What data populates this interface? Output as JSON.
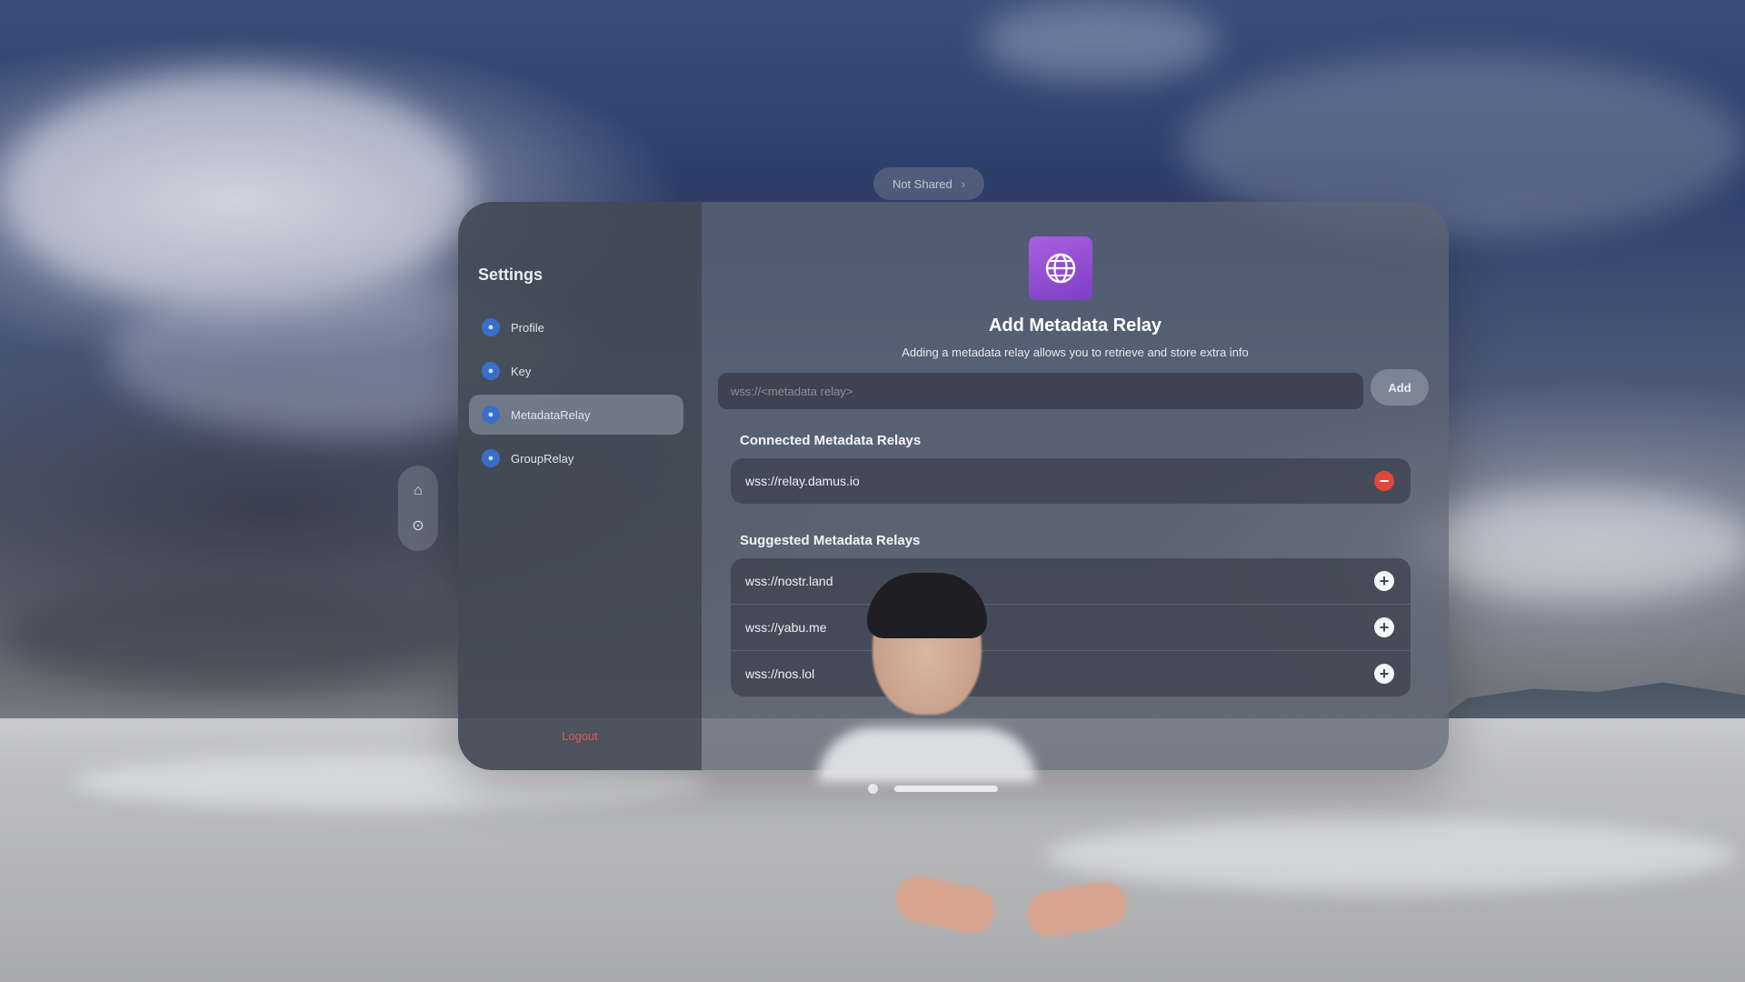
{
  "environment": {
    "share_pill": {
      "label": "Not Shared",
      "chevron": "›"
    }
  },
  "ornament": {
    "items": [
      {
        "icon": "home-icon",
        "glyph": "⌂"
      },
      {
        "icon": "compass-icon",
        "glyph": "⊙"
      }
    ]
  },
  "sidebar": {
    "title": "Settings",
    "items": [
      {
        "label": "Profile",
        "icon": "profile-icon",
        "selected": false
      },
      {
        "label": "Key",
        "icon": "key-icon",
        "selected": false
      },
      {
        "label": "MetadataRelay",
        "icon": "metadata-relay-icon",
        "selected": true
      },
      {
        "label": "GroupRelay",
        "icon": "group-relay-icon",
        "selected": false
      }
    ],
    "logout_label": "Logout"
  },
  "main": {
    "icon": "globe-icon",
    "title": "Add Metadata Relay",
    "subtitle": "Adding a metadata relay allows you to retrieve and store extra info",
    "input": {
      "placeholder": "wss://<metadata relay>",
      "value": ""
    },
    "add_button": "Add",
    "connected": {
      "header": "Connected Metadata Relays",
      "items": [
        {
          "url": "wss://relay.damus.io"
        }
      ]
    },
    "suggested": {
      "header": "Suggested Metadata Relays",
      "items": [
        {
          "url": "wss://nostr.land"
        },
        {
          "url": "wss://yabu.me"
        },
        {
          "url": "wss://nos.lol"
        }
      ]
    }
  },
  "colors": {
    "accent_purple": "#9b53d8",
    "destructive_red": "#e0473b",
    "logout_red": "#e25b4b",
    "sidebar_icon_blue": "#3a6fc8"
  }
}
